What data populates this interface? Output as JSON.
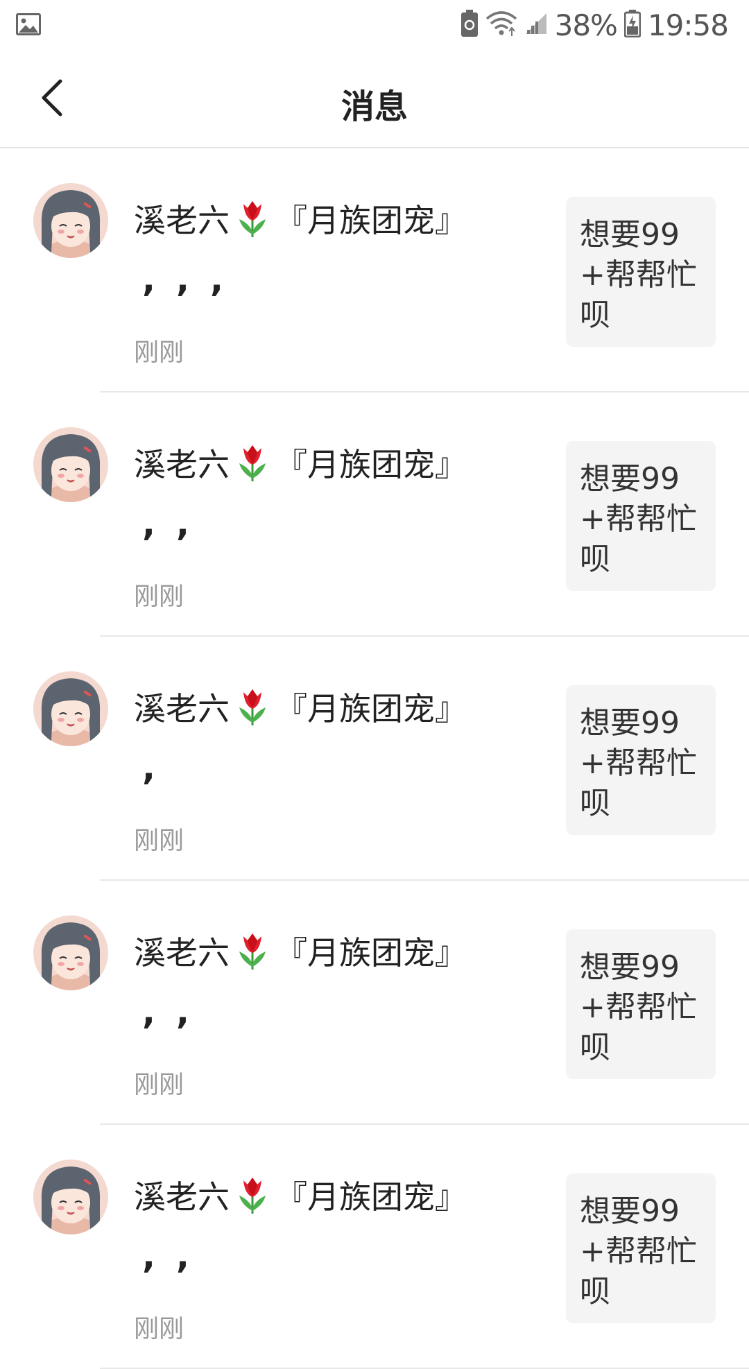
{
  "status_bar": {
    "battery_percent": "38%",
    "time": "19:58",
    "icons": [
      "image-notification-icon",
      "battery-saver-icon",
      "wifi-icon",
      "signal-icon",
      "battery-icon"
    ]
  },
  "header": {
    "title": "消息",
    "back_icon": "chevron-left-icon"
  },
  "messages": [
    {
      "name_prefix": "溪老六",
      "emoji": "tulip-icon",
      "name_suffix": "『月族团宠』",
      "content": ",,,",
      "time": "刚刚",
      "card_text": "想要99+帮帮忙呗"
    },
    {
      "name_prefix": "溪老六",
      "emoji": "tulip-icon",
      "name_suffix": "『月族团宠』",
      "content": ",,",
      "time": "刚刚",
      "card_text": "想要99+帮帮忙呗"
    },
    {
      "name_prefix": "溪老六",
      "emoji": "tulip-icon",
      "name_suffix": "『月族团宠』",
      "content": ",",
      "time": "刚刚",
      "card_text": "想要99+帮帮忙呗"
    },
    {
      "name_prefix": "溪老六",
      "emoji": "tulip-icon",
      "name_suffix": "『月族团宠』",
      "content": ",,",
      "time": "刚刚",
      "card_text": "想要99+帮帮忙呗"
    },
    {
      "name_prefix": "溪老六",
      "emoji": "tulip-icon",
      "name_suffix": "『月族团宠』",
      "content": ",,",
      "time": "刚刚",
      "card_text": "想要99+帮帮忙呗"
    }
  ]
}
